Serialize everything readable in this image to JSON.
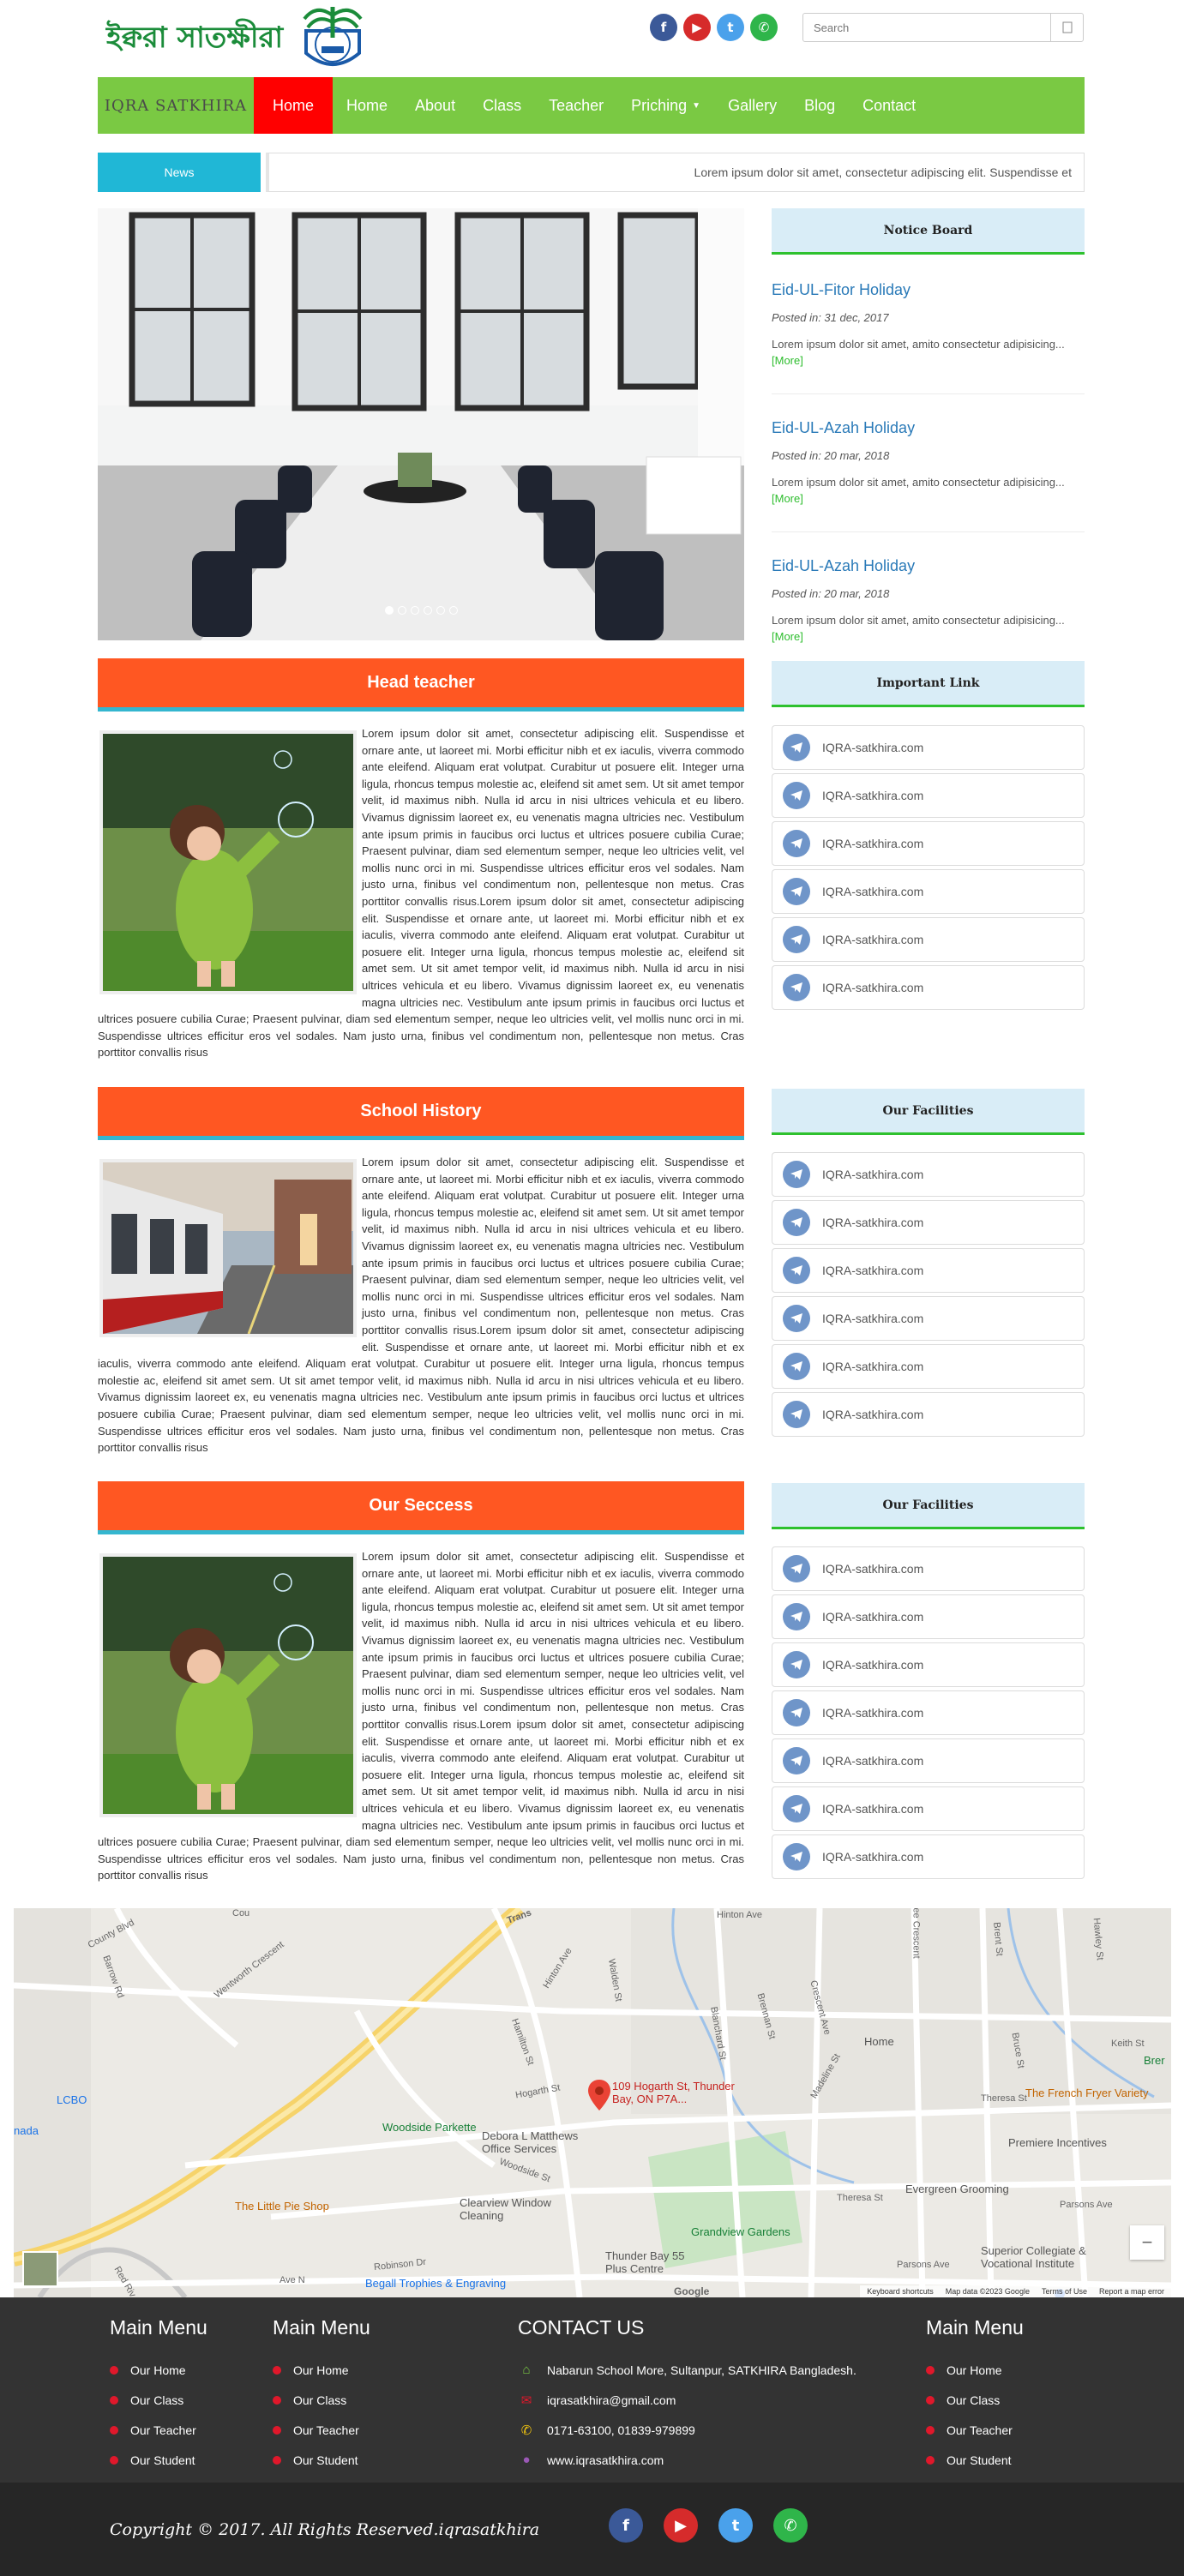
{
  "header": {
    "logo_text": "ইক্বরা সাতক্ষীরা",
    "search_placeholder": "Search"
  },
  "nav": {
    "brand": "IQRA SATKHIRA",
    "items": [
      {
        "label": "Home"
      },
      {
        "label": "Home"
      },
      {
        "label": "About"
      },
      {
        "label": "Class"
      },
      {
        "label": "Teacher"
      },
      {
        "label": "Priching"
      },
      {
        "label": "Gallery"
      },
      {
        "label": "Blog"
      },
      {
        "label": "Contact"
      }
    ]
  },
  "news": {
    "label": "News",
    "ticker": "Lorem ipsum dolor sit amet, consectetur adipiscing elit. Suspendisse et"
  },
  "notice_board": {
    "title": "Notice Board",
    "items": [
      {
        "title": "Eid-UL-Fitor Holiday",
        "date": "Posted in: 31 dec, 2017",
        "text": "Lorem ipsum dolor sit amet, amito consectetur adipisicing...",
        "more": "[More]"
      },
      {
        "title": "Eid-UL-Azah Holiday",
        "date": "Posted in: 20 mar, 2018",
        "text": "Lorem ipsum dolor sit amet, amito consectetur adipisicing...",
        "more": "[More]"
      },
      {
        "title": "Eid-UL-Azah Holiday",
        "date": "Posted in: 20 mar, 2018",
        "text": "Lorem ipsum dolor sit amet, amito consectetur adipisicing...",
        "more": "[More]"
      }
    ]
  },
  "important_links": {
    "title": "Important Link",
    "items": [
      "IQRA-satkhira.com",
      "IQRA-satkhira.com",
      "IQRA-satkhira.com",
      "IQRA-satkhira.com",
      "IQRA-satkhira.com",
      "IQRA-satkhira.com"
    ]
  },
  "facilities_1": {
    "title": "Our Facilities",
    "items": [
      "IQRA-satkhira.com",
      "IQRA-satkhira.com",
      "IQRA-satkhira.com",
      "IQRA-satkhira.com",
      "IQRA-satkhira.com",
      "IQRA-satkhira.com"
    ]
  },
  "facilities_2": {
    "title": "Our Facilities",
    "items": [
      "IQRA-satkhira.com",
      "IQRA-satkhira.com",
      "IQRA-satkhira.com",
      "IQRA-satkhira.com",
      "IQRA-satkhira.com",
      "IQRA-satkhira.com",
      "IQRA-satkhira.com"
    ]
  },
  "sections": {
    "head_teacher": {
      "title": "Head teacher",
      "text": "Lorem ipsum dolor sit amet, consectetur adipiscing elit. Suspendisse et ornare ante, ut laoreet mi. Morbi efficitur nibh et ex iaculis, viverra commodo ante eleifend. Aliquam erat volutpat. Curabitur ut posuere elit. Integer urna ligula, rhoncus tempus molestie ac, eleifend sit amet sem. Ut sit amet tempor velit, id maximus nibh. Nulla id arcu in nisi ultrices vehicula et eu libero. Vivamus dignissim laoreet ex, eu venenatis magna ultricies nec. Vestibulum ante ipsum primis in faucibus orci luctus et ultrices posuere cubilia Curae; Praesent pulvinar, diam sed elementum semper, neque leo ultricies velit, vel mollis nunc orci in mi. Suspendisse ultrices efficitur eros vel sodales. Nam justo urna, finibus vel condimentum non, pellentesque non metus. Cras porttitor convallis risus.Lorem ipsum dolor sit amet, consectetur adipiscing elit. Suspendisse et ornare ante, ut laoreet mi. Morbi efficitur nibh et ex iaculis, viverra commodo ante eleifend. Aliquam erat volutpat. Curabitur ut posuere elit. Integer urna ligula, rhoncus tempus molestie ac, eleifend sit amet sem. Ut sit amet tempor velit, id maximus nibh. Nulla id arcu in nisi ultrices vehicula et eu libero. Vivamus dignissim laoreet ex, eu venenatis magna ultricies nec. Vestibulum ante ipsum primis in faucibus orci luctus et ultrices posuere cubilia Curae; Praesent pulvinar, diam sed elementum semper, neque leo ultricies velit, vel mollis nunc orci in mi. Suspendisse ultrices efficitur eros vel sodales. Nam justo urna, finibus vel condimentum non, pellentesque non metus. Cras porttitor convallis risus"
    },
    "school_history": {
      "title": "School History",
      "text": "Lorem ipsum dolor sit amet, consectetur adipiscing elit. Suspendisse et ornare ante, ut laoreet mi. Morbi efficitur nibh et ex iaculis, viverra commodo ante eleifend. Aliquam erat volutpat. Curabitur ut posuere elit. Integer urna ligula, rhoncus tempus molestie ac, eleifend sit amet sem. Ut sit amet tempor velit, id maximus nibh. Nulla id arcu in nisi ultrices vehicula et eu libero. Vivamus dignissim laoreet ex, eu venenatis magna ultricies nec. Vestibulum ante ipsum primis in faucibus orci luctus et ultrices posuere cubilia Curae; Praesent pulvinar, diam sed elementum semper, neque leo ultricies velit, vel mollis nunc orci in mi. Suspendisse ultrices efficitur eros vel sodales. Nam justo urna, finibus vel condimentum non, pellentesque non metus. Cras porttitor convallis risus.Lorem ipsum dolor sit amet, consectetur adipiscing elit. Suspendisse et ornare ante, ut laoreet mi. Morbi efficitur nibh et ex iaculis, viverra commodo ante eleifend. Aliquam erat volutpat. Curabitur ut posuere elit. Integer urna ligula, rhoncus tempus molestie ac, eleifend sit amet sem. Ut sit amet tempor velit, id maximus nibh. Nulla id arcu in nisi ultrices vehicula et eu libero. Vivamus dignissim laoreet ex, eu venenatis magna ultricies nec. Vestibulum ante ipsum primis in faucibus orci luctus et ultrices posuere cubilia Curae; Praesent pulvinar, diam sed elementum semper, neque leo ultricies velit, vel mollis nunc orci in mi. Suspendisse ultrices efficitur eros vel sodales. Nam justo urna, finibus vel condimentum non, pellentesque non metus. Cras porttitor convallis risus"
    },
    "our_success": {
      "title": "Our Seccess",
      "text": "Lorem ipsum dolor sit amet, consectetur adipiscing elit. Suspendisse et ornare ante, ut laoreet mi. Morbi efficitur nibh et ex iaculis, viverra commodo ante eleifend. Aliquam erat volutpat. Curabitur ut posuere elit. Integer urna ligula, rhoncus tempus molestie ac, eleifend sit amet sem. Ut sit amet tempor velit, id maximus nibh. Nulla id arcu in nisi ultrices vehicula et eu libero. Vivamus dignissim laoreet ex, eu venenatis magna ultricies nec. Vestibulum ante ipsum primis in faucibus orci luctus et ultrices posuere cubilia Curae; Praesent pulvinar, diam sed elementum semper, neque leo ultricies velit, vel mollis nunc orci in mi. Suspendisse ultrices efficitur eros vel sodales. Nam justo urna, finibus vel condimentum non, pellentesque non metus. Cras porttitor convallis risus.Lorem ipsum dolor sit amet, consectetur adipiscing elit. Suspendisse et ornare ante, ut laoreet mi. Morbi efficitur nibh et ex iaculis, viverra commodo ante eleifend. Aliquam erat volutpat. Curabitur ut posuere elit. Integer urna ligula, rhoncus tempus molestie ac, eleifend sit amet sem. Ut sit amet tempor velit, id maximus nibh. Nulla id arcu in nisi ultrices vehicula et eu libero. Vivamus dignissim laoreet ex, eu venenatis magna ultricies nec. Vestibulum ante ipsum primis in faucibus orci luctus et ultrices posuere cubilia Curae; Praesent pulvinar, diam sed elementum semper, neque leo ultricies velit, vel mollis nunc orci in mi. Suspendisse ultrices efficitur eros vel sodales. Nam justo urna, finibus vel condimentum non, pellentesque non metus. Cras porttitor convallis risus"
    }
  },
  "map": {
    "pin_label": "109 Hogarth St, Thunder Bay, ON P7A...",
    "streets": [
      "County Blvd",
      "Cou",
      "Wentworth Crescent",
      "Barrow Rd",
      "Trans",
      "Hinton Ave",
      "Hinton Ave",
      "Walden St",
      "Blanchard St",
      "Brennan St",
      "Crescent Ave",
      "Lee Crescent",
      "Brent St",
      "Hawley St",
      "Keith St",
      "Bruce St",
      "Madeline St",
      "Hogarth St",
      "Hamilton St",
      "Woodside St",
      "Theresa St",
      "Theresa St",
      "Parsons Ave",
      "Parsons Ave",
      "Robinson Dr",
      "Ave N",
      "Red Riv"
    ],
    "places": [
      "Woodside Parkette",
      "Debora L Matthews Office Services",
      "The Little Pie Shop",
      "Clearview Window Cleaning",
      "Grandview Gardens",
      "The French Fryer Variety",
      "Premiere Incentives",
      "Evergreen Grooming",
      "Home",
      "Superior Collegiate & Vocational Institute",
      "LCBO",
      "Begall Trophies & Engraving",
      "Thunder Bay 55 Plus Centre",
      "Brer",
      "nada"
    ],
    "attribution": [
      "Keyboard shortcuts",
      "Map data ©2023 Google",
      "Terms of Use",
      "Report a map error"
    ]
  },
  "footer": {
    "menu_1": {
      "title": "Main Menu",
      "items": [
        "Our Home",
        "Our Class",
        "Our Teacher",
        "Our Student"
      ]
    },
    "menu_2": {
      "title": "Main Menu",
      "items": [
        "Our Home",
        "Our Class",
        "Our Teacher",
        "Our Student"
      ]
    },
    "contact": {
      "title": "CONTACT US",
      "address": "Nabarun School More, Sultanpur, SATKHIRA Bangladesh.",
      "email": "iqrasatkhira@gmail.com",
      "phone": "0171-63100, 01839-979899",
      "web": "www.iqrasatkhira.com"
    },
    "menu_3": {
      "title": "Main Menu",
      "items": [
        "Our Home",
        "Our Class",
        "Our Teacher",
        "Our Student"
      ]
    },
    "copyright": "Copyright © 2017. All Rights Reserved.iqrasatkhira"
  },
  "colors": {
    "nav_green": "#7ac943",
    "active_red": "#ff0000",
    "section_orange": "#ff5722",
    "accent_cyan": "#20b7d6",
    "sidebar_head": "#d9edf7"
  }
}
